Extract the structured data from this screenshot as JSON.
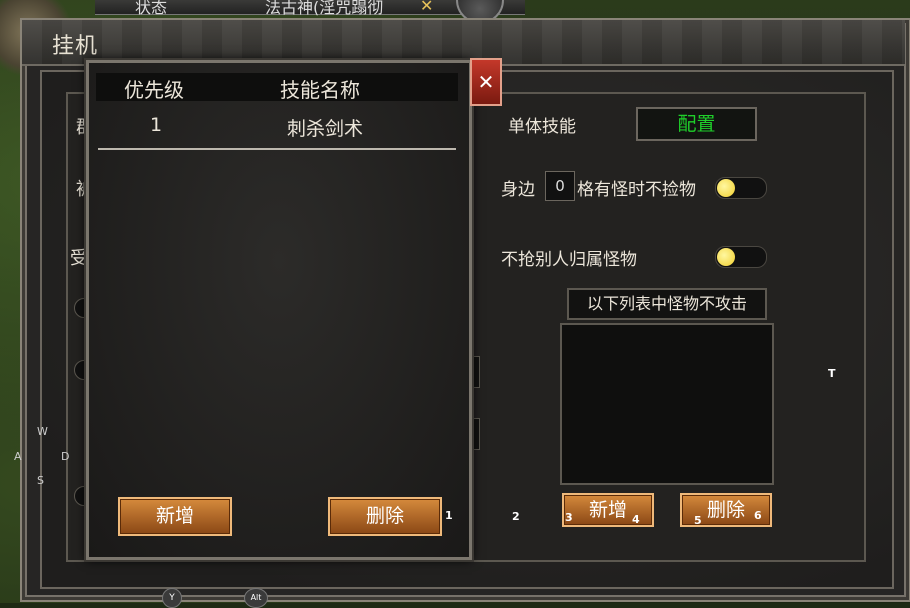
{
  "topbar": {
    "tab_label": "状态",
    "player_text": "法古神(淫咒蹋彻",
    "x_mark": "✕"
  },
  "window": {
    "title": "挂机"
  },
  "settings": {
    "single_skill_label": "单体技能",
    "config_button": "配置",
    "pickup_prefix": "身边",
    "pickup_value": "0",
    "pickup_suffix": "格有怪时不捡物",
    "no_steal_label": "不抢别人归属怪物",
    "monster_list_title": "以下列表中怪物不攻击",
    "add_button": "新增",
    "delete_button": "删除"
  },
  "left_hidden_labels": [
    "群",
    "被",
    "受"
  ],
  "skill_panel": {
    "col_priority": "优先级",
    "col_skill_name": "技能名称",
    "rows": [
      {
        "priority": "1",
        "skill": "刺杀剑术"
      }
    ],
    "add_button": "新增",
    "delete_button": "删除",
    "close_symbol": "✕"
  },
  "key_hints": {
    "k1": "1",
    "k2": "2",
    "k3": "3",
    "k4": "4",
    "k5": "5",
    "k6": "6",
    "t": "T",
    "w": "W",
    "a": "A",
    "s": "S",
    "d": "D",
    "y": "Y",
    "alt": "Alt"
  },
  "toggles": {
    "pickup_toggle_on": true,
    "no_steal_toggle_on": true
  },
  "colors": {
    "config_text": "#1fcf2a",
    "toggle_knob": "#f1cf2c",
    "button_fill": "#b8692a",
    "close_button": "#a52a1c"
  }
}
